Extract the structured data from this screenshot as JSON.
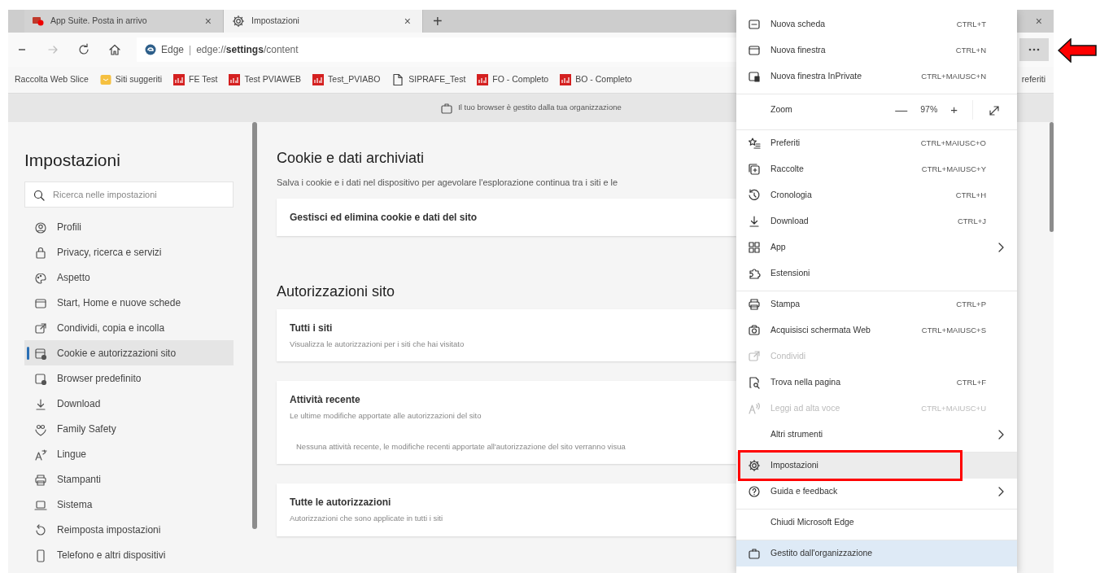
{
  "tabs": [
    {
      "title": "App Suite. Posta in arrivo",
      "selected": false,
      "close": "×"
    },
    {
      "title": "Impostazioni",
      "selected": true,
      "close": "×"
    }
  ],
  "new_tab": "+",
  "window_close": "×",
  "toolbar": {
    "site_label": "Edge",
    "separator": "|",
    "url": "edge://**settings**/content"
  },
  "bookmarks": [
    {
      "label": "Raccolta Web Slice",
      "kind": "plain"
    },
    {
      "label": "Siti suggeriti",
      "kind": "folder"
    },
    {
      "label": "FE Test",
      "kind": "app"
    },
    {
      "label": "Test PVIAWEB",
      "kind": "app"
    },
    {
      "label": "Test_PVIABO",
      "kind": "app"
    },
    {
      "label": "SIPRAFE_Test",
      "kind": "page"
    },
    {
      "label": "FO - Completo",
      "kind": "app"
    },
    {
      "label": "BO - Completo",
      "kind": "app"
    }
  ],
  "bookmarks_overflow": "referiti",
  "banner": "Il tuo browser è gestito dalla tua organizzazione",
  "sidebar": {
    "title": "Impostazioni",
    "search": {
      "placeholder": "Ricerca nelle impostazioni"
    },
    "items": [
      {
        "label": "Profili",
        "selected": false
      },
      {
        "label": "Privacy, ricerca e servizi",
        "selected": false
      },
      {
        "label": "Aspetto",
        "selected": false
      },
      {
        "label": "Start, Home e nuove schede",
        "selected": false
      },
      {
        "label": "Condividi, copia e incolla",
        "selected": false
      },
      {
        "label": "Cookie e autorizzazioni sito",
        "selected": true
      },
      {
        "label": "Browser predefinito",
        "selected": false
      },
      {
        "label": "Download",
        "selected": false
      },
      {
        "label": "Family Safety",
        "selected": false
      },
      {
        "label": "Lingue",
        "selected": false
      },
      {
        "label": "Stampanti",
        "selected": false
      },
      {
        "label": "Sistema",
        "selected": false
      },
      {
        "label": "Reimposta impostazioni",
        "selected": false
      },
      {
        "label": "Telefono e altri dispositivi",
        "selected": false
      }
    ]
  },
  "main": {
    "sections": [
      {
        "heading": "Cookie e dati archiviati",
        "description": "Salva i cookie e i dati nel dispositivo per agevolare l'esplorazione continua tra i siti e le",
        "cards": [
          {
            "title": "Gestisci ed elimina cookie e dati del sito"
          }
        ]
      },
      {
        "heading": "Autorizzazioni sito",
        "cards": [
          {
            "title": "Tutti i siti",
            "subtitle": "Visualizza le autorizzazioni per i siti che hai visitato"
          },
          {
            "title": "Attività recente",
            "subtitle": "Le ultime modifiche apportate alle autorizzazioni del sito",
            "note": "Nessuna attività recente, le modifiche recenti apportate all'autorizzazione del sito verranno visua"
          },
          {
            "title": "Tutte le autorizzazioni",
            "subtitle": "Autorizzazioni che sono applicate in tutti i siti"
          }
        ]
      }
    ]
  },
  "menu": {
    "groups": [
      [
        {
          "kind": "command",
          "label": "Nuova scheda",
          "shortcut": "CTRL+T",
          "submenu": false,
          "disabled": false,
          "hovered": false
        },
        {
          "kind": "command",
          "label": "Nuova finestra",
          "shortcut": "CTRL+N",
          "submenu": false,
          "disabled": false,
          "hovered": false
        },
        {
          "kind": "command",
          "label": "Nuova finestra InPrivate",
          "shortcut": "CTRL+MAIUSC+N",
          "submenu": false,
          "disabled": false,
          "hovered": false
        }
      ],
      [
        {
          "kind": "zoom",
          "label": "Zoom",
          "minus": "—",
          "value": "97%",
          "plus": "+"
        }
      ],
      [
        {
          "kind": "command",
          "label": "Preferiti",
          "shortcut": "CTRL+MAIUSC+O",
          "submenu": false,
          "disabled": false,
          "hovered": false
        },
        {
          "kind": "command",
          "label": "Raccolte",
          "shortcut": "CTRL+MAIUSC+Y",
          "submenu": false,
          "disabled": false,
          "hovered": false
        },
        {
          "kind": "command",
          "label": "Cronologia",
          "shortcut": "CTRL+H",
          "submenu": false,
          "disabled": false,
          "hovered": false
        },
        {
          "kind": "command",
          "label": "Download",
          "shortcut": "CTRL+J",
          "submenu": false,
          "disabled": false,
          "hovered": false
        },
        {
          "kind": "command",
          "label": "App",
          "submenu": true,
          "disabled": false,
          "hovered": false
        },
        {
          "kind": "command",
          "label": "Estensioni",
          "submenu": false,
          "disabled": false,
          "hovered": false
        }
      ],
      [
        {
          "kind": "command",
          "label": "Stampa",
          "shortcut": "CTRL+P",
          "submenu": false,
          "disabled": false,
          "hovered": false
        },
        {
          "kind": "command",
          "label": "Acquisisci schermata Web",
          "shortcut": "CTRL+MAIUSC+S",
          "submenu": false,
          "disabled": false,
          "hovered": false
        },
        {
          "kind": "command",
          "label": "Condividi",
          "submenu": false,
          "disabled": true,
          "hovered": false
        },
        {
          "kind": "command",
          "label": "Trova nella pagina",
          "shortcut": "CTRL+F",
          "submenu": false,
          "disabled": false,
          "hovered": false
        },
        {
          "kind": "command",
          "label": "Leggi ad alta voce",
          "shortcut": "CTRL+MAIUSC+U",
          "submenu": false,
          "disabled": true,
          "hovered": false
        },
        {
          "kind": "command",
          "label": "Altri strumenti",
          "submenu": true,
          "disabled": false,
          "hovered": false
        }
      ],
      [
        {
          "kind": "command",
          "label": "Impostazioni",
          "submenu": false,
          "disabled": false,
          "hovered": true
        },
        {
          "kind": "command",
          "label": "Guida e feedback",
          "submenu": true,
          "disabled": false,
          "hovered": false
        }
      ],
      [
        {
          "kind": "command",
          "label": "Chiudi Microsoft Edge",
          "submenu": false,
          "disabled": false,
          "hovered": false
        }
      ],
      [
        {
          "kind": "managed",
          "label": "Gestito dall'organizzazione"
        }
      ]
    ]
  }
}
